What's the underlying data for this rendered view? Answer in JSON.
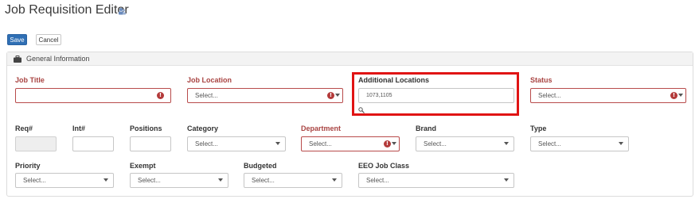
{
  "header": {
    "title": "Job Requisition Editor",
    "title_icon": "users-icon"
  },
  "toolbar": {
    "save_label": "Save",
    "cancel_label": "Cancel"
  },
  "panel": {
    "title": "General Information",
    "icon": "briefcase-icon"
  },
  "fields": {
    "job_title": {
      "label": "Job Title",
      "value": ""
    },
    "job_location": {
      "label": "Job Location",
      "value": "Select..."
    },
    "additional_locations": {
      "label": "Additional Locations",
      "value": "1073,1105"
    },
    "status": {
      "label": "Status",
      "value": "Select..."
    },
    "req_num": {
      "label": "Req#",
      "value": ""
    },
    "int_num": {
      "label": "Int#",
      "value": ""
    },
    "positions": {
      "label": "Positions",
      "value": ""
    },
    "category": {
      "label": "Category",
      "value": "Select..."
    },
    "department": {
      "label": "Department",
      "value": "Select..."
    },
    "brand": {
      "label": "Brand",
      "value": "Select..."
    },
    "type": {
      "label": "Type",
      "value": "Select..."
    },
    "priority": {
      "label": "Priority",
      "value": "Select..."
    },
    "exempt": {
      "label": "Exempt",
      "value": "Select..."
    },
    "budgeted": {
      "label": "Budgeted",
      "value": "Select..."
    },
    "eeo_job_class": {
      "label": "EEO Job Class",
      "value": "Select..."
    }
  },
  "colors": {
    "accent": "#2f6fb4",
    "required": "#a94442",
    "highlight": "#e01414"
  }
}
